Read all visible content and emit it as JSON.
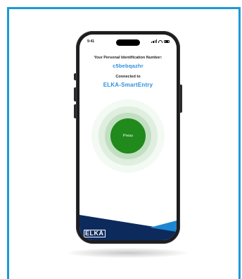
{
  "status_bar": {
    "time": "9:41"
  },
  "screen": {
    "pid_label": "Your Personal Identification Number:",
    "pid_value": "c5bebqazhr",
    "connected_label": "Connected to",
    "device_name": "ELKA-SmartEntry",
    "press_button_label": "Press"
  },
  "footer": {
    "logo": "ELKA"
  },
  "colors": {
    "frame_accent": "#1c9ad6",
    "text_accent": "#2b8fe0",
    "button_green": "#208a1c",
    "footer_navy": "#0d2a5c",
    "footer_blue": "#1e86d0"
  }
}
